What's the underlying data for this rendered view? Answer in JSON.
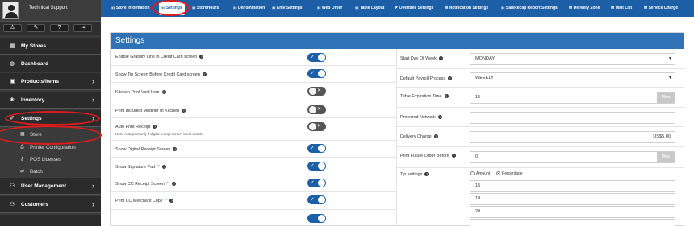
{
  "user": {
    "name": "Technical Support"
  },
  "quickbar": {
    "icons": [
      "user-icon",
      "tool-icon",
      "help-icon",
      "logout-icon"
    ],
    "glyphs": [
      "♙",
      "✎",
      "?",
      "⇥"
    ]
  },
  "sidebar": {
    "items": [
      {
        "label": "My Stores",
        "icon": "▦"
      },
      {
        "label": "Dashboard",
        "icon": "◍"
      },
      {
        "label": "Products/Items",
        "icon": "▣",
        "chevron": "›"
      },
      {
        "label": "Inventory",
        "icon": "❀",
        "chevron": "›"
      },
      {
        "label": "Settings",
        "icon": "✐",
        "chevron": "›"
      },
      {
        "label": "User Management",
        "icon": "⚇",
        "chevron": "›"
      },
      {
        "label": "Customers",
        "icon": "⚇",
        "chevron": "›"
      }
    ],
    "sub_items": [
      {
        "label": "Store",
        "icon": "▦"
      },
      {
        "label": "Printer Configuration",
        "icon": "⎙"
      },
      {
        "label": "POS Licenses",
        "icon": "⚷"
      },
      {
        "label": "Batch",
        "icon": "⇄"
      }
    ]
  },
  "topbar": {
    "tabs": [
      "☷ Store Information",
      "☷ Settings",
      "☷ StoreHours",
      "☷ Denomination",
      "☷ Emv Settings",
      "☷ Web Order",
      "☷ Table Layout",
      "✐ Overtime Settings",
      "✉ Notification Settings",
      "☷ SaleRecap Report Settings",
      "✉ Delivery Zone",
      "✉ Wait List",
      "✉ Service Charge"
    ],
    "active_tab": "Settings"
  },
  "settings": {
    "title": "Settings",
    "toggles": [
      {
        "label": "Enable Gratuity Line in Credit Card screen",
        "state": "on"
      },
      {
        "label": "Show Tip Screen Before Credit Card screen",
        "state": "on"
      },
      {
        "label": "Kitchen Print Void Item",
        "state": "off"
      },
      {
        "label": "Print Included Modifier In Kitchen",
        "state": "off"
      },
      {
        "label": "Auto Print Receipt",
        "note": "Note: Auto print only if digital receipt screen is not enable",
        "state": "off"
      },
      {
        "label": "Show Digital Receipt Screen",
        "state": "on"
      },
      {
        "label": "Show Signature Pad",
        "star": "**",
        "state": "on"
      },
      {
        "label": "Show CC Receipt Screen",
        "star": "**",
        "state": "on"
      },
      {
        "label": "Print CC Merchant Copy",
        "star": "**",
        "state": "on"
      }
    ],
    "on_mark": "✓",
    "off_mark": "✕",
    "help_mark": "?",
    "right": {
      "start_day_label": "Start Day Of Week",
      "start_day_value": "MONDAY",
      "payroll_label": "Default Payroll Process",
      "payroll_value": "WEEKLY",
      "table_exp_label": "Table Expiration Time",
      "table_exp_value": "15",
      "table_exp_unit": "Mins",
      "network_label": "Preferred Network",
      "network_value": "",
      "delivery_label": "Delivery Charge",
      "delivery_value": "US$5.00",
      "future_label": "Print Future Order Before",
      "future_value": "0",
      "future_unit": "Mins",
      "tip_label": "Tip settings",
      "tip_amount_label": "Amount",
      "tip_percentage_label": "Percentage",
      "tip_selected": "Percentage",
      "tip_values": [
        "15",
        "18",
        "20"
      ],
      "caret": "▾"
    }
  },
  "colors": {
    "topbar": "#1c5fa6",
    "header": "#2f73b6",
    "sidebar": "#2b2b2b",
    "toggle_on": "#1c5fa6",
    "annotation": "#e01b1b"
  }
}
